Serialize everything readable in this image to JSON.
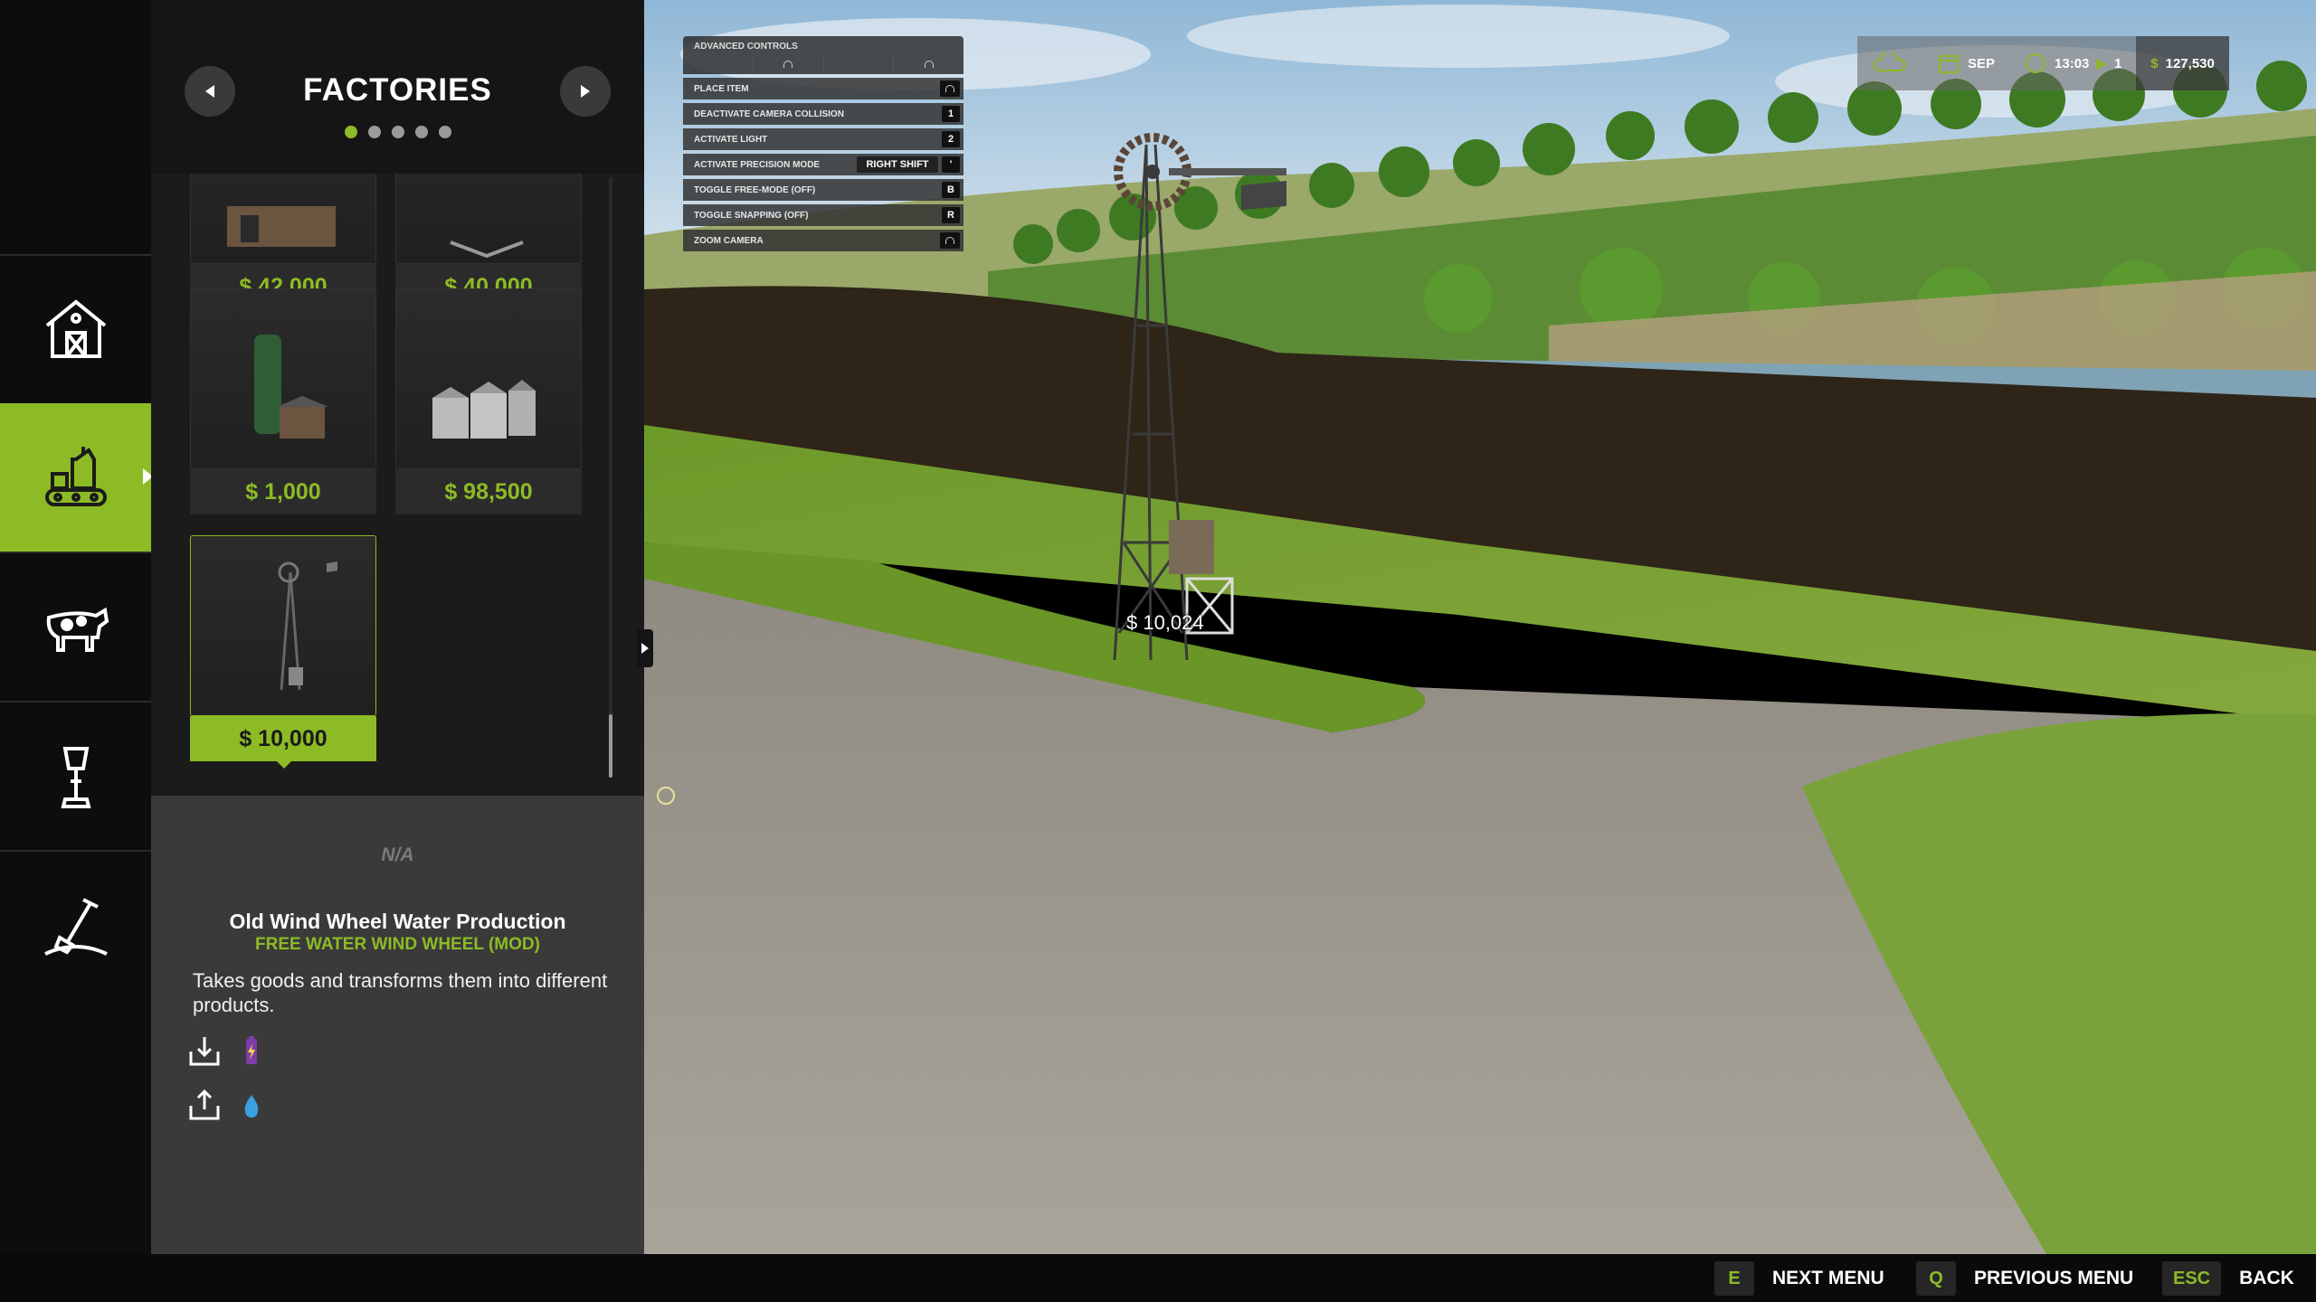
{
  "panel": {
    "title": "FACTORIES",
    "page_count": 5,
    "active_page": 1
  },
  "rail": {
    "items": [
      {
        "icon": "farmhouse-icon",
        "active": false
      },
      {
        "icon": "factory-conveyor-icon",
        "active": true
      },
      {
        "icon": "cow-icon",
        "active": false
      },
      {
        "icon": "lamp-post-icon",
        "active": false
      },
      {
        "icon": "shovel-icon",
        "active": false
      }
    ]
  },
  "store": {
    "items": [
      {
        "price": "$ 42,000",
        "thumb": "farm-shed"
      },
      {
        "price": "$ 40,000",
        "thumb": "equipment"
      },
      {
        "price": "$ 1,000",
        "thumb": "silo-shed"
      },
      {
        "price": "$ 98,500",
        "thumb": "grain-silos"
      },
      {
        "price": "$ 10,000",
        "thumb": "windmill",
        "selected": true
      }
    ]
  },
  "info": {
    "na": "N/A",
    "name": "Old Wind Wheel Water Production",
    "subtitle": "FREE WATER WIND WHEEL (MOD)",
    "description": "Takes goods and transforms them into different products.",
    "input_icon": "battery-icon",
    "output_icon": "water-drop-icon"
  },
  "controls": {
    "title": "ADVANCED CONTROLS",
    "rows": [
      {
        "label": "PLACE ITEM",
        "key": "mouse"
      },
      {
        "label": "DEACTIVATE CAMERA COLLISION",
        "key": "1"
      },
      {
        "label": "ACTIVATE LIGHT",
        "key": "2"
      },
      {
        "label": "ACTIVATE PRECISION MODE",
        "key_alt": "RIGHT SHIFT",
        "key": "'"
      },
      {
        "label": "TOGGLE FREE-MODE (OFF)",
        "key": "B"
      },
      {
        "label": "TOGGLE SNAPPING (OFF)",
        "key": "R"
      },
      {
        "label": "ZOOM CAMERA",
        "key": "mouse"
      }
    ]
  },
  "hud": {
    "month": "SEP",
    "time": "13:03",
    "speed": "1",
    "money": "127,530",
    "money_symbol": "$"
  },
  "placement": {
    "price": "$ 10,024"
  },
  "bottom": {
    "hints": [
      {
        "key": "E",
        "label": "NEXT MENU"
      },
      {
        "key": "Q",
        "label": "PREVIOUS MENU"
      },
      {
        "key": "ESC",
        "label": "BACK"
      }
    ]
  },
  "colors": {
    "accent": "#8dbb25",
    "panel": "#1b1b1b",
    "info_bg": "#3a3a3a"
  }
}
